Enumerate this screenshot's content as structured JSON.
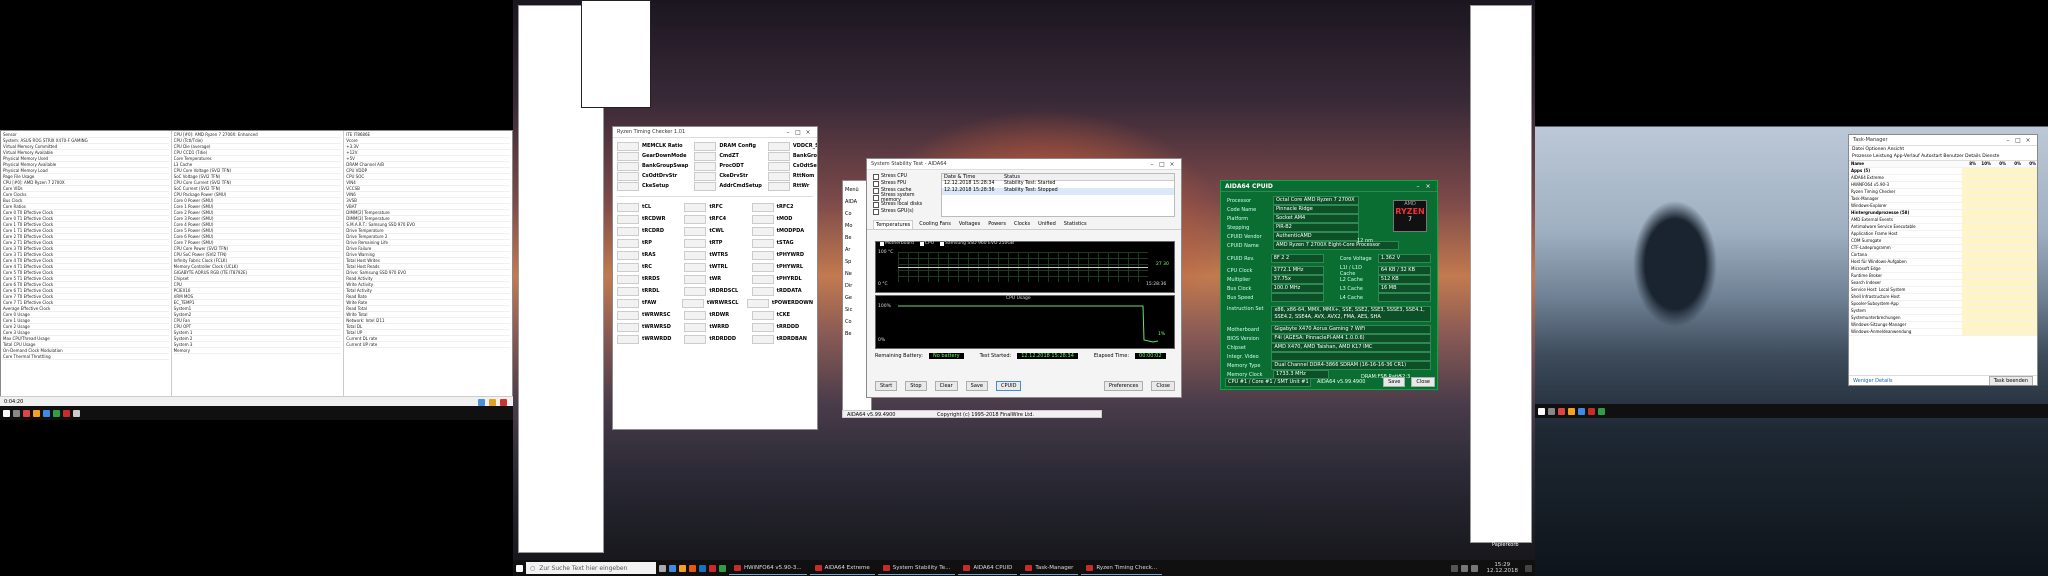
{
  "taskbar_main": {
    "search_placeholder": "Zur Suche Text hier eingeben",
    "buttons": [
      {
        "label": "HWiNFO64 v5.90-3..."
      },
      {
        "label": "AIDA64 Extreme"
      },
      {
        "label": "System Stability Te..."
      },
      {
        "label": "AIDA64 CPUID"
      },
      {
        "label": "Task-Manager"
      },
      {
        "label": "Ryzen Timing Check..."
      }
    ],
    "time": "15:29",
    "date": "12.12.2018"
  },
  "right_corner_text": "Papierkorb",
  "hwinfo": {
    "rows_left": [
      "Sensor",
      "System: ASUS ROG STRIX X470-F GAMING",
      "Virtual Memory Committed",
      "Virtual Memory Available",
      "Physical Memory Used",
      "Physical Memory Available",
      "Physical Memory Load",
      "Page File Usage",
      "CPU [#0]: AMD Ryzen 7 2700X",
      "Core VIDs",
      "Core Clocks",
      "Bus Clock",
      "Core Ratios",
      "Core 0 T0 Effective Clock",
      "Core 0 T1 Effective Clock",
      "Core 1 T0 Effective Clock",
      "Core 1 T1 Effective Clock",
      "Core 2 T0 Effective Clock",
      "Core 2 T1 Effective Clock",
      "Core 3 T0 Effective Clock",
      "Core 3 T1 Effective Clock",
      "Core 4 T0 Effective Clock",
      "Core 4 T1 Effective Clock",
      "Core 5 T0 Effective Clock",
      "Core 5 T1 Effective Clock",
      "Core 6 T0 Effective Clock",
      "Core 6 T1 Effective Clock",
      "Core 7 T0 Effective Clock",
      "Core 7 T1 Effective Clock",
      "Average Effective Clock",
      "Core 0 Usage",
      "Core 1 Usage",
      "Core 2 Usage",
      "Core 3 Usage",
      "Max CPU/Thread Usage",
      "Total CPU Usage",
      "On-Demand Clock Modulation",
      "Core Thermal Throttling"
    ],
    "rows_mid": [
      "CPU [#0]: AMD Ryzen 7 2700X: Enhanced",
      "CPU (Tctl/Tdie)",
      "CPU Die (average)",
      "CPU CCD1 (Tdie)",
      "Core Temperatures",
      "L3 Cache",
      "CPU Core Voltage (SVI2 TFN)",
      "SoC Voltage (SVI2 TFN)",
      "CPU Core Current (SVI2 TFN)",
      "SoC Current (SVI2 TFN)",
      "CPU Package Power (SMU)",
      "Core 0 Power (SMU)",
      "Core 1 Power (SMU)",
      "Core 2 Power (SMU)",
      "Core 3 Power (SMU)",
      "Core 4 Power (SMU)",
      "Core 5 Power (SMU)",
      "Core 6 Power (SMU)",
      "Core 7 Power (SMU)",
      "CPU Core Power (SVI2 TFN)",
      "CPU SoC Power (SVI2 TFN)",
      "Infinity Fabric Clock (FCLK)",
      "Memory Controller Clock (UCLK)",
      "GIGABYTE AORUS RGB (ITE IT8792E)",
      "Chipset",
      "CPU",
      "PCIEX16",
      "VRM MOS",
      "EC_TEMP1",
      "System1",
      "System2",
      "CPU Fan",
      "CPU OPT",
      "System 1",
      "System 2",
      "System 3",
      "Memory"
    ],
    "rows_right": [
      "ITE IT8686E",
      "Vcore",
      "+3.3V",
      "+12V",
      "+5V",
      "DRAM Channel A/B",
      "CPU VDDP",
      "CPU SOC",
      "VIN4",
      "VCCSB",
      "VIN6",
      "3VSB",
      "VBAT",
      "DIMM[2] Temperature",
      "DIMM[3] Temperature",
      "S.M.A.R.T.: Samsung SSD 970 EVO",
      "Drive Temperature",
      "Drive Temperature 2",
      "Drive Remaining Life",
      "Drive Failure",
      "Drive Warning",
      "Total Host Writes",
      "Total Host Reads",
      "Drive: Samsung SSD 970 EVO",
      "Read Activity",
      "Write Activity",
      "Total Activity",
      "Read Rate",
      "Write Rate",
      "Read Total",
      "Write Total",
      "Network: Intel I211",
      "Total DL",
      "Total UP",
      "Current DL rate",
      "Current UP rate"
    ],
    "status_time": "0:04:20"
  },
  "ryzen_timing": {
    "title": "Ryzen Timing Checker 1.01",
    "col_labels": [
      [
        "MEMCLK Ratio",
        "GearDownMode",
        "BankGroupSwap",
        "CsOdtDrvStr",
        "CkeSetup"
      ],
      [
        "DRAM Config",
        "CmdZT",
        "ProcODT",
        "CkeDrvStr",
        "AddrCmdSetup"
      ],
      [
        "VDDCR_SoC (V)",
        "BankGroupSwapAlt",
        "CsOdtSetup",
        "RttNom",
        "RttWr"
      ]
    ],
    "timing_rows": [
      [
        "tCL",
        "tRFC",
        "tRFC2"
      ],
      [
        "tRCDWR",
        "tRFC4",
        "tMOD"
      ],
      [
        "tRCDRD",
        "tCWL",
        "tMODPDA"
      ],
      [
        "tRP",
        "tRTP",
        "tSTAG"
      ],
      [
        "tRAS",
        "tWTRS",
        "tPHYWRD"
      ],
      [
        "tRC",
        "tWTRL",
        "tPHYWRL"
      ],
      [
        "tRRDS",
        "tWR",
        "tPHYRDL"
      ],
      [
        "tRRDL",
        "tRDRDSCL",
        "tRDDATA"
      ],
      [
        "tFAW",
        "tWRWRSCL",
        "tPOWERDOWN"
      ],
      [
        "tWRWRSC",
        "tRDWR",
        "tCKE"
      ],
      [
        "tWRWRSD",
        "tWRRD",
        "tRRDDD"
      ],
      [
        "tWRWRDD",
        "tRDRDDD",
        "tRDRDBAN"
      ]
    ]
  },
  "stability": {
    "title": "System Stability Test - AIDA64",
    "checks": [
      "Stress CPU",
      "Stress FPU",
      "Stress cache",
      "Stress system memory",
      "Stress local disks",
      "Stress GPU(s)"
    ],
    "table_headers": [
      "Date & Time",
      "Status"
    ],
    "table_rows": [
      {
        "time": "12.12.2018 15:28:34",
        "status": "Stability Test: Started"
      },
      {
        "time": "12.12.2018 15:28:36",
        "status": "Stability Test: Stopped"
      }
    ],
    "tabs": [
      "Temperatures",
      "Cooling Fans",
      "Voltages",
      "Powers",
      "Clocks",
      "Unified",
      "Statistics"
    ],
    "legend": [
      "Motherboard",
      "CPU",
      "Samsung SSD 960 EVO 250GB"
    ],
    "graph1_top": "100 °C",
    "graph1_bottom": "0 °C",
    "graph1_time": "15:28:36",
    "graph1_val": "27 30",
    "graph2_title": "CPU Usage",
    "graph2_top": "100%",
    "graph2_bottom": "0%",
    "graph2_val": "1%",
    "remaining_battery_label": "Remaining Battery:",
    "remaining_battery": "No battery",
    "test_started_label": "Test Started:",
    "test_started": "12.12.2018 15:28:34",
    "elapsed_label": "Elapsed Time:",
    "elapsed": "00:00:02",
    "buttons": [
      "Start",
      "Stop",
      "Clear",
      "Save",
      "CPUID",
      "Preferences",
      "Close"
    ],
    "footer_left": "AIDA64 v5.99.4900",
    "footer_right": "Copyright (c) 1995-2018 FinalWire Ltd."
  },
  "aida_side_items": [
    "Menü",
    "AIDA",
    "Co",
    "Mo",
    "Be",
    "Ar",
    "Sp",
    "Ne",
    "Dir",
    "Ge",
    "Sic",
    "Co",
    "Be"
  ],
  "cpuid": {
    "title": "AIDA64 CPUID",
    "fields": [
      {
        "label": "Processor",
        "value": "Octal Core AMD Ryzen 7 2700X"
      },
      {
        "label": "Code Name",
        "value": "Pinnacle Ridge"
      },
      {
        "label": "Platform",
        "value": "Socket AM4"
      },
      {
        "label": "Stepping",
        "value": "PiR-B2"
      },
      {
        "label": "CPUID Vendor",
        "value": "AuthenticAMD"
      },
      {
        "label": "CPUID Name",
        "value": "AMD Ryzen 7 2700X Eight-Core Processor"
      }
    ],
    "nm": "12 nm",
    "cpuid_rev_label": "CPUID Rev.",
    "cpuid_rev": "8F  2  2",
    "core_voltage_label": "Core Voltage",
    "core_voltage": "1.362 V",
    "clocks": [
      {
        "label": "CPU Clock",
        "value": "3772.1 MHz",
        "label2": "L1I / L1D Cache",
        "value2": "64 KB / 32 KB"
      },
      {
        "label": "Multiplier",
        "value": "37.75x",
        "label2": "L2 Cache",
        "value2": "512 KB"
      },
      {
        "label": "Bus Clock",
        "value": "100.0 MHz",
        "label2": "L3 Cache",
        "value2": "16 MB"
      },
      {
        "label": "Bus Speed",
        "value": "",
        "label2": "L4 Cache",
        "value2": ""
      }
    ],
    "iset_label": "Instruction Set",
    "iset": "x86, x86-64, MMX, MMX+, SSE, SSE2, SSE3, SSSE3, SSE4.1, SSE4.2, SSE4A, AVX, AVX2, FMA, AES, SHA",
    "board": [
      {
        "label": "Motherboard",
        "value": "Gigabyte X470 Aorus Gaming 7 WiFi"
      },
      {
        "label": "BIOS Version",
        "value": "F4i  (AGESA: PinnaclePI-AM4 1.0.0.6)"
      },
      {
        "label": "Chipset",
        "value": "AMD X470, AMD Taishan, AMD K17 IMC"
      },
      {
        "label": "Integr. Video",
        "value": ""
      },
      {
        "label": "Memory Type",
        "value": "Dual Channel DDR4-3866 SDRAM  (16-16-16-36 CR1)"
      },
      {
        "label": "Memory Clock",
        "value": "1733.3 MHz"
      }
    ],
    "dram_ratio_label": "DRAM:FSB Ratio",
    "dram_ratio": "52:3",
    "cpu_select": "CPU #1 / Core #1 / SMT Unit #1",
    "version": "AIDA64 v5.99.4900",
    "save_btn": "Save",
    "close_btn": "Close",
    "badge_brand": "AMD",
    "badge_name": "RYZEN",
    "badge_num": "7"
  },
  "taskmgr": {
    "title": "Task-Manager",
    "menu": "Datei  Optionen  Ansicht",
    "tabs": "Prozesse  Leistung  App-Verlauf  Autostart  Benutzer  Details  Dienste",
    "headers": [
      "Name",
      "8%",
      "10%",
      "0%",
      "0%",
      "0%"
    ],
    "rows": [
      "Apps (5)",
      "AIDA64 Extreme",
      "HWiNFO64 v5.90-3",
      "Ryzen Timing Checker",
      "Task-Manager",
      "Windows-Explorer",
      "Hintergrundprozesse (58)",
      "AMD External Events",
      "Antimalware Service Executable",
      "Application Frame Host",
      "COM Surrogate",
      "CTF-Ladeprogramm",
      "Cortana",
      "Host für Windows-Aufgaben",
      "Microsoft Edge",
      "Runtime Broker",
      "Search Indexer",
      "Service Host: Local System",
      "Shell Infrastructure Host",
      "Spooler-Subsystem-App",
      "System",
      "Systemunterbrechungen",
      "Windows-Sitzungs-Manager",
      "Windows-Anmeldeanwendung"
    ],
    "footer": "Weniger Details",
    "end_btn": "Task beenden"
  }
}
